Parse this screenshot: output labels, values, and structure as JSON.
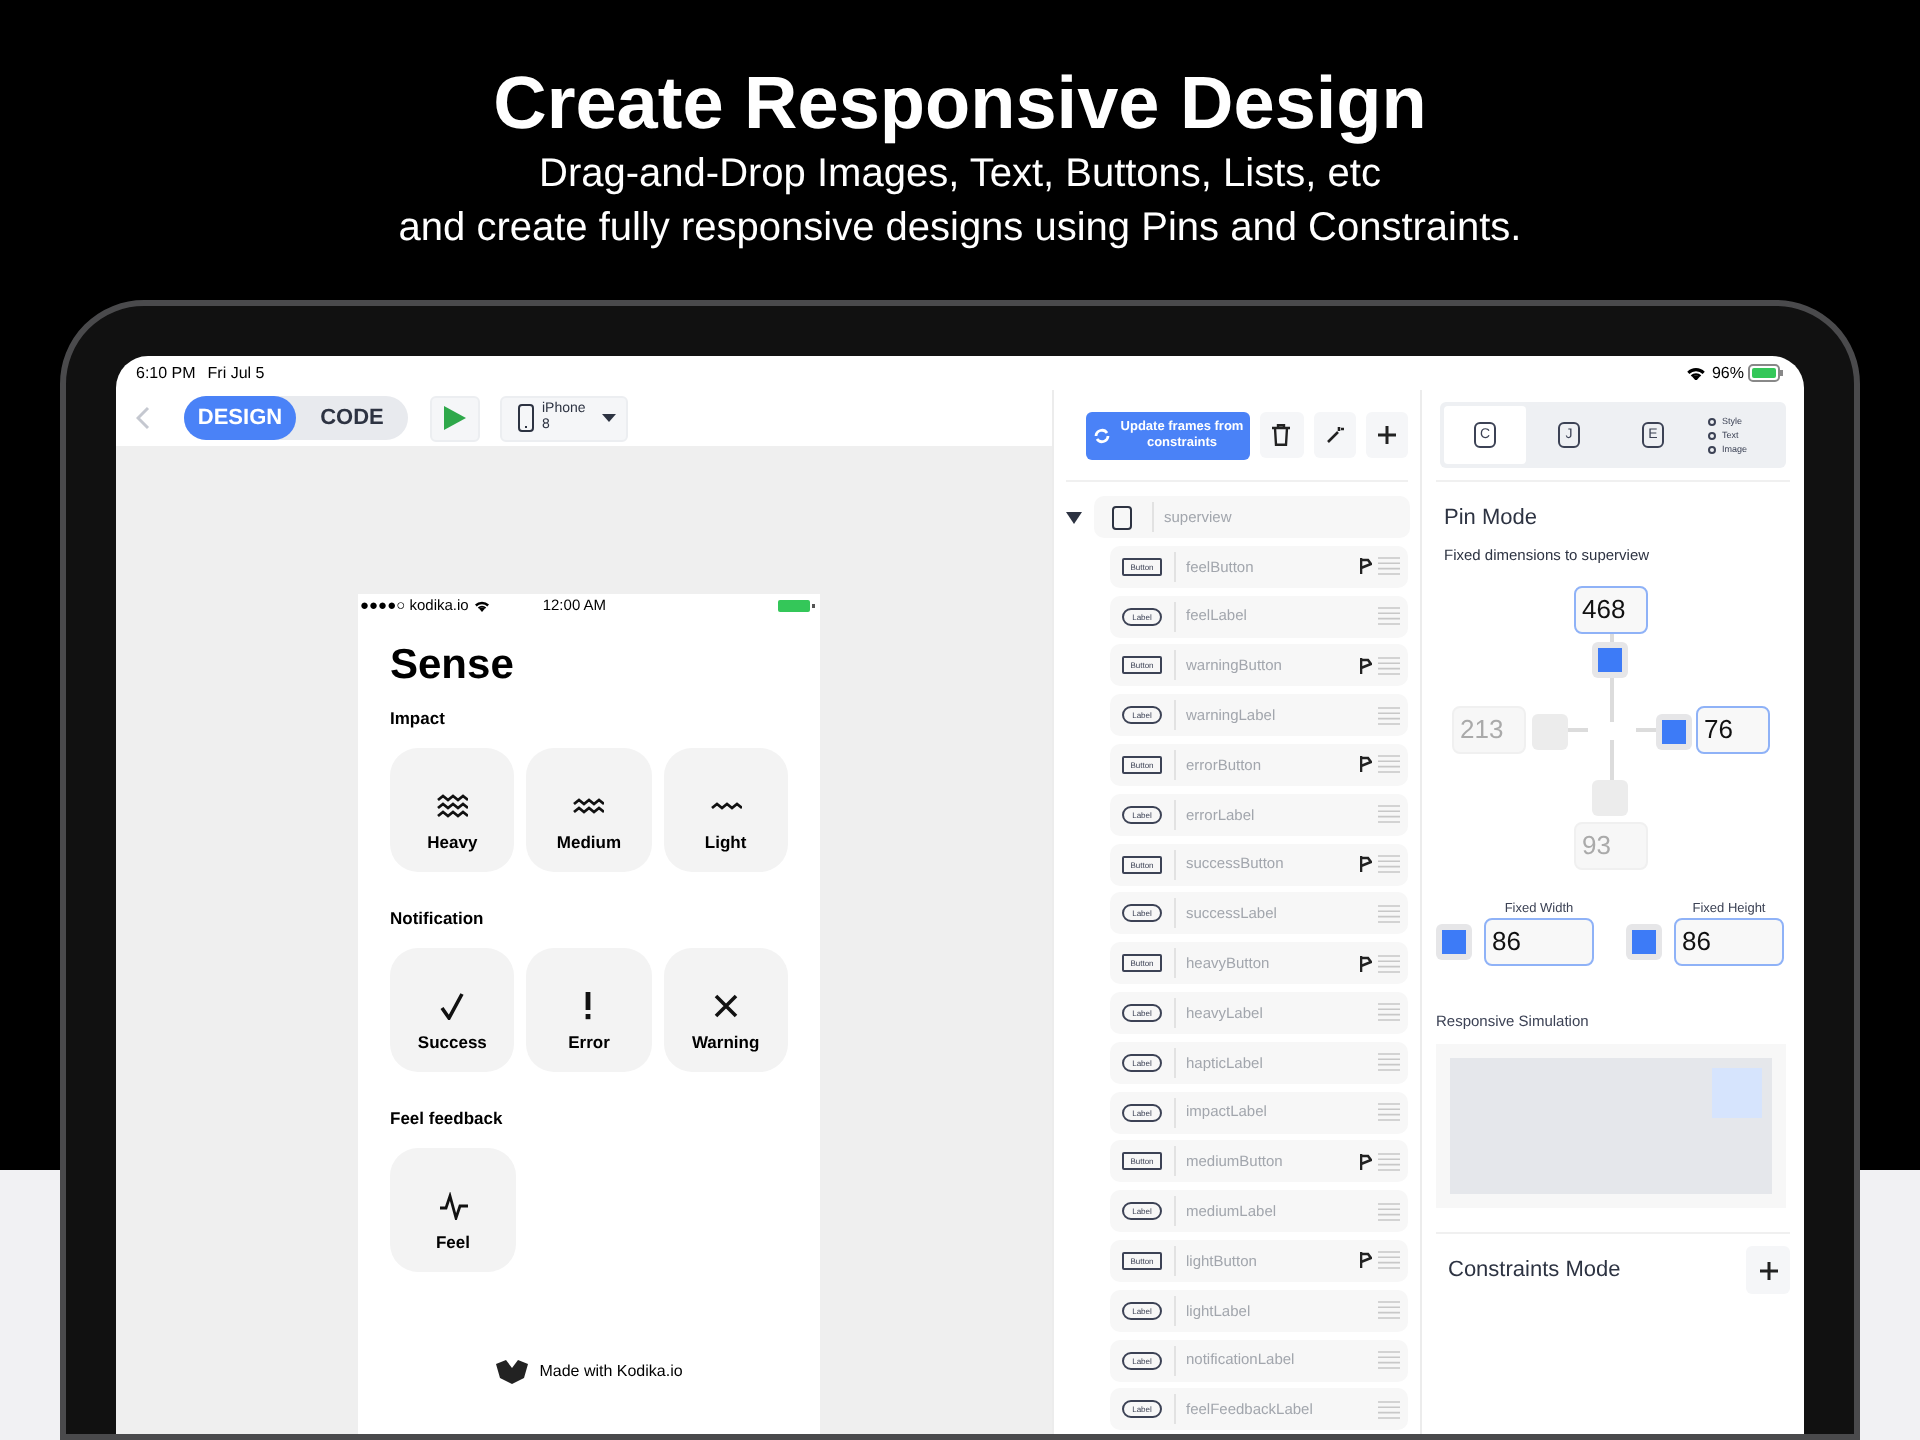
{
  "header": {
    "title": "Create Responsive Design",
    "lines": [
      "Drag-and-Drop Images, Text, Buttons, Lists, etc",
      "and create fully responsive designs using Pins and Constraints."
    ]
  },
  "status_bar": {
    "time": "6:10 PM",
    "date": "Fri Jul 5",
    "battery": "96%"
  },
  "toolbar": {
    "modes": [
      {
        "label": "DESIGN",
        "selected": true
      },
      {
        "label": "CODE",
        "selected": false
      }
    ],
    "device": "iPhone 8"
  },
  "preview": {
    "carrier": "●●●●○ kodika.io",
    "time": "12:00 AM",
    "title": "Sense",
    "footer": "Made with Kodika.io",
    "sections": [
      {
        "heading": "Impact",
        "buttons": [
          {
            "kind": "heavy",
            "label": "Heavy"
          },
          {
            "kind": "medium",
            "label": "Medium"
          },
          {
            "kind": "light",
            "label": "Light"
          }
        ]
      },
      {
        "heading": "Notification",
        "buttons": [
          {
            "kind": "check",
            "label": "Success"
          },
          {
            "kind": "exclaim",
            "label": "Error"
          },
          {
            "kind": "cross",
            "label": "Warning"
          }
        ]
      },
      {
        "heading": "Feel feedback",
        "buttons": [
          {
            "kind": "pulse",
            "label": "Feel"
          }
        ]
      }
    ]
  },
  "layers": {
    "update_button": "Update frames from constraints",
    "root": {
      "name": "superview",
      "expanded": true
    },
    "items": [
      {
        "kind": "button",
        "badge": "Button",
        "name": "feelButton"
      },
      {
        "kind": "label",
        "badge": "Label",
        "name": "feelLabel"
      },
      {
        "kind": "button",
        "badge": "Button",
        "name": "warningButton"
      },
      {
        "kind": "label",
        "badge": "Label",
        "name": "warningLabel"
      },
      {
        "kind": "button",
        "badge": "Button",
        "name": "errorButton"
      },
      {
        "kind": "label",
        "badge": "Label",
        "name": "errorLabel"
      },
      {
        "kind": "button",
        "badge": "Button",
        "name": "successButton"
      },
      {
        "kind": "label",
        "badge": "Label",
        "name": "successLabel"
      },
      {
        "kind": "button",
        "badge": "Button",
        "name": "heavyButton"
      },
      {
        "kind": "label",
        "badge": "Label",
        "name": "heavyLabel"
      },
      {
        "kind": "label",
        "badge": "Label",
        "name": "hapticLabel"
      },
      {
        "kind": "label",
        "badge": "Label",
        "name": "impactLabel"
      },
      {
        "kind": "button",
        "badge": "Button",
        "name": "mediumButton"
      },
      {
        "kind": "label",
        "badge": "Label",
        "name": "mediumLabel"
      },
      {
        "kind": "button",
        "badge": "Button",
        "name": "lightButton"
      },
      {
        "kind": "label",
        "badge": "Label",
        "name": "lightLabel"
      },
      {
        "kind": "label",
        "badge": "Label",
        "name": "notificationLabel"
      },
      {
        "kind": "label",
        "badge": "Label",
        "name": "feelFeedbackLabel"
      }
    ]
  },
  "inspector": {
    "tabs": [
      {
        "label": "C",
        "selected": true
      },
      {
        "label": "J",
        "selected": false
      },
      {
        "label": "E",
        "selected": false
      }
    ],
    "options": [
      {
        "label": "Style",
        "selected": false
      },
      {
        "label": "Text",
        "selected": false
      },
      {
        "label": "Image",
        "selected": false
      }
    ],
    "pin_mode": {
      "title": "Pin Mode",
      "subtitle": "Fixed dimensions to superview",
      "top": {
        "value": "468",
        "on": true
      },
      "left": {
        "value": "213",
        "on": false
      },
      "right": {
        "value": "76",
        "on": true
      },
      "bottom": {
        "value": "93",
        "on": false
      },
      "width": {
        "label": "Fixed Width",
        "value": "86",
        "on": true
      },
      "height": {
        "label": "Fixed Height",
        "value": "86",
        "on": true
      }
    },
    "simulation": {
      "title": "Responsive Simulation"
    },
    "constraints": {
      "title": "Constraints Mode"
    }
  }
}
